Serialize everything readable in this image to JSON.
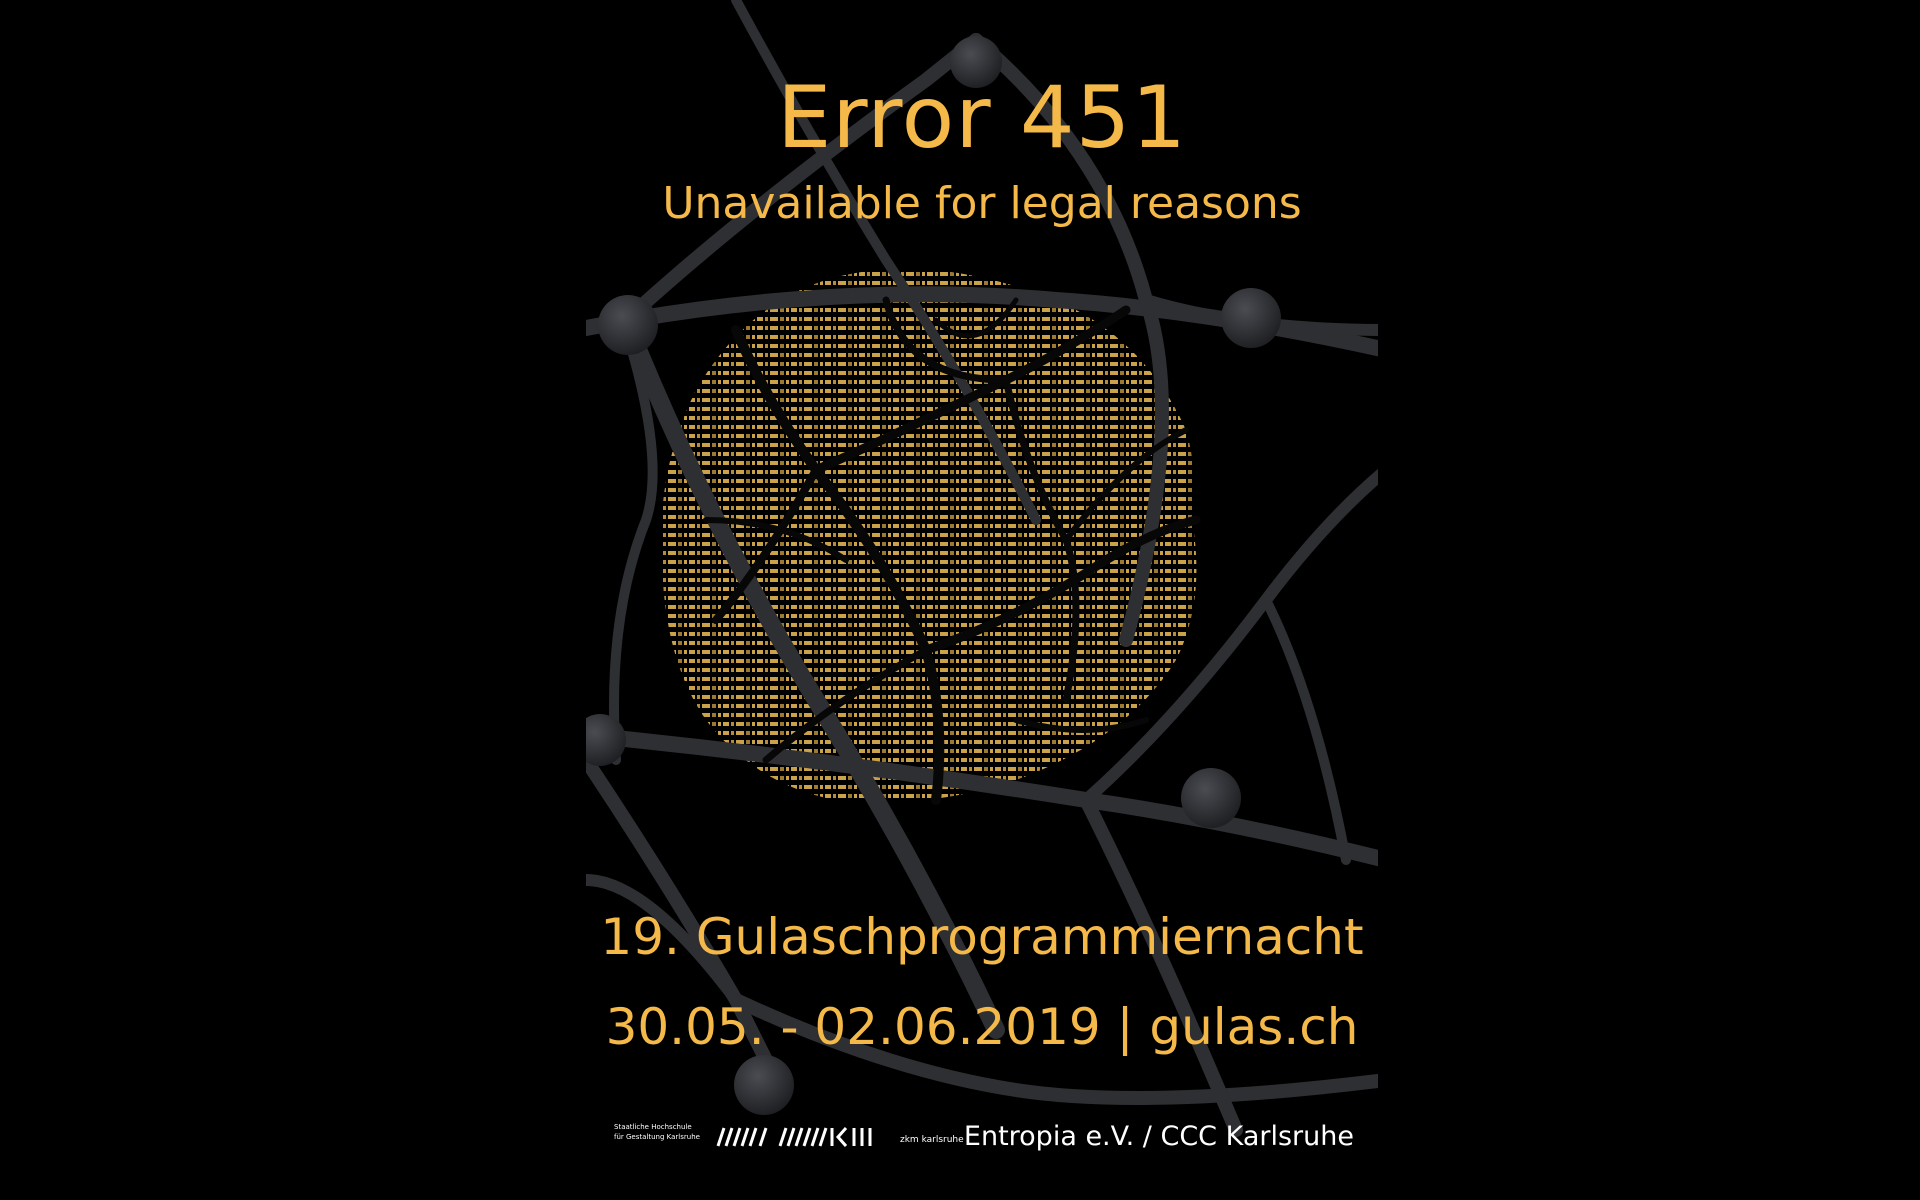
{
  "poster": {
    "title": "Error 451",
    "subtitle": "Unavailable for legal reasons",
    "event": "19. Gulaschprogrammiernacht",
    "dates": "30.05. - 02.06.2019 | gulas.ch",
    "footer": {
      "hfg_line1": "Staatliche Hochschule",
      "hfg_line2": "für Gestaltung Karlsruhe",
      "zkm_text": "zkm karlsruhe",
      "organizer": "Entropia e.V. / CCC Karlsruhe"
    }
  },
  "colors": {
    "background": "#000000",
    "accent": "#f5b94a",
    "text_white": "#ffffff",
    "network": "#3a3b3f"
  },
  "illustration": "network-globe-with-text-fragments"
}
